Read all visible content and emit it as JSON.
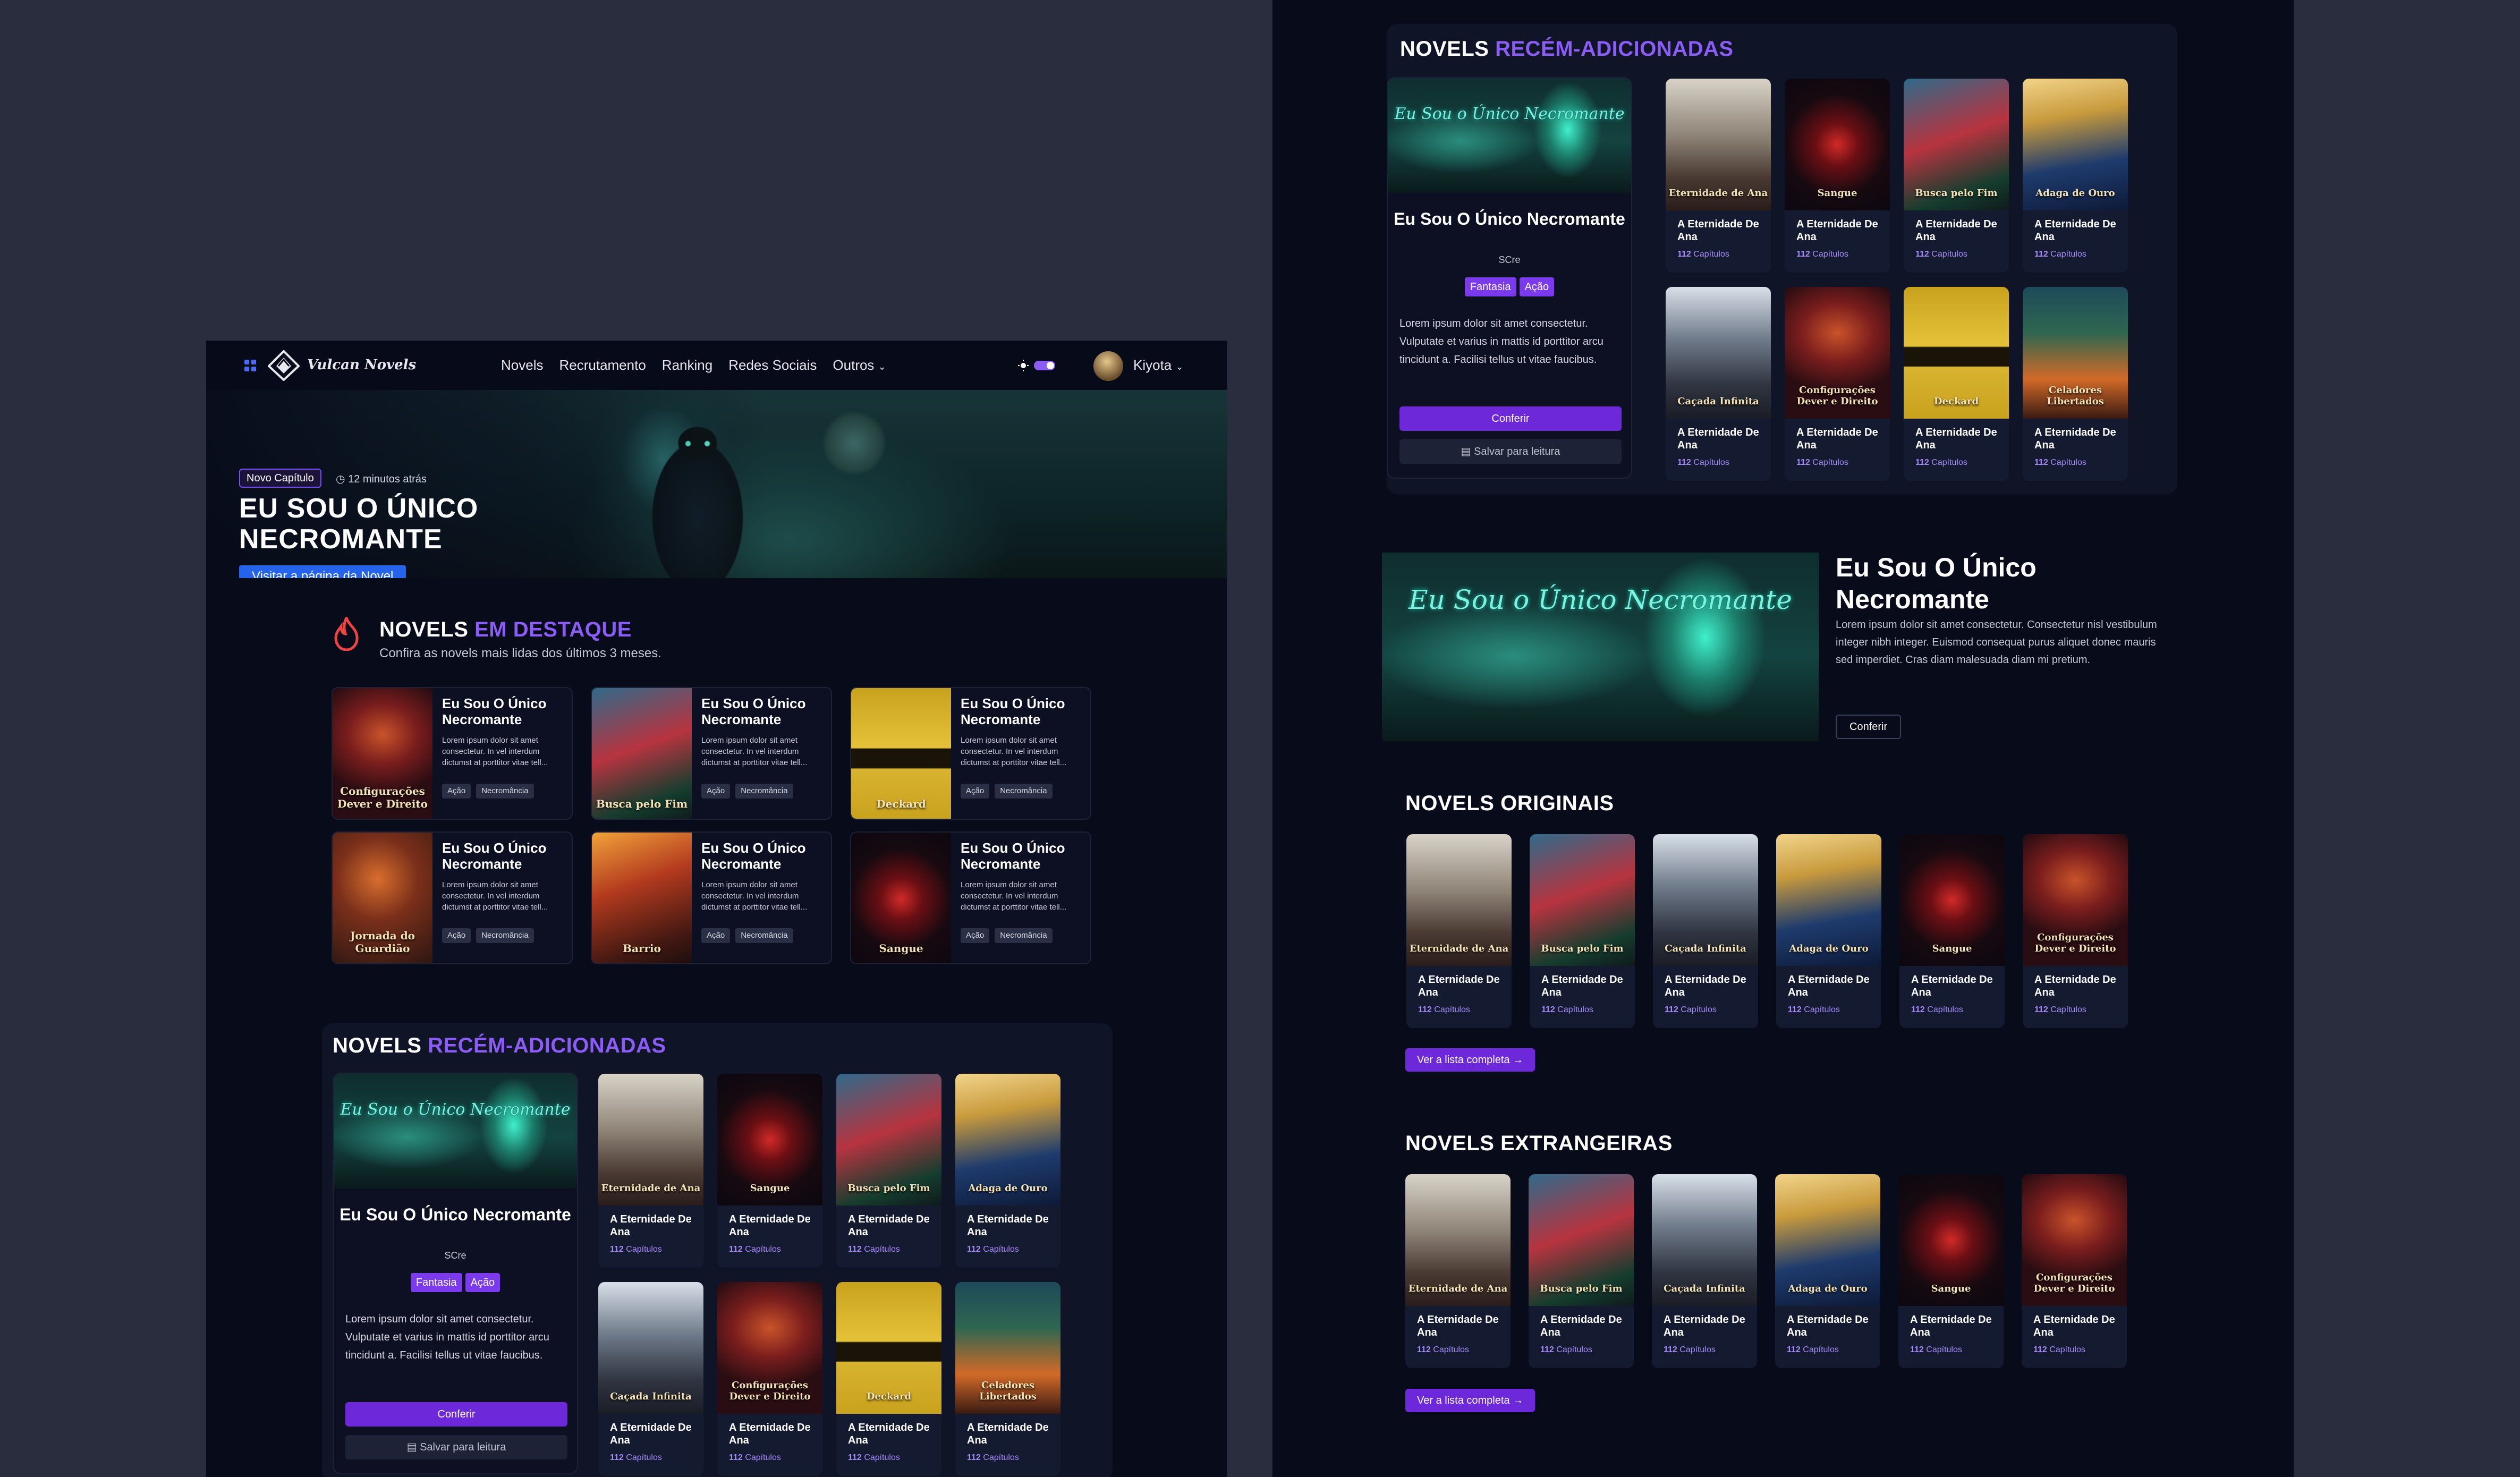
{
  "header": {
    "logo_text": "Vulcan Novels",
    "nav": [
      "Novels",
      "Recrutamento",
      "Ranking",
      "Redes Sociais",
      "Outros"
    ],
    "user_name": "Kiyota",
    "theme": "dark"
  },
  "hero": {
    "badge": "Novo Capítulo",
    "time": "12 minutos atrás",
    "title": "EU SOU O ÚNICO NECROMANTE",
    "button": "Visitar a página da Novel"
  },
  "featured": {
    "title_main": "NOVELS ",
    "title_accent": "EM DESTAQUE",
    "subtitle": "Confira as novels mais lidas dos últimos 3 meses.",
    "cards": [
      {
        "title": "Eu Sou O Único Necromante",
        "desc": "Lorem ipsum dolor sit amet consectetur. In vel interdum dictumst at porttitor vitae tell...",
        "tags": [
          "Ação",
          "Necromância"
        ],
        "cover": "Configurações Dever e Direito"
      },
      {
        "title": "Eu Sou O Único Necromante",
        "desc": "Lorem ipsum dolor sit amet consectetur. In vel interdum dictumst at porttitor vitae tell...",
        "tags": [
          "Ação",
          "Necromância"
        ],
        "cover": "Busca pelo Fim"
      },
      {
        "title": "Eu Sou O Único Necromante",
        "desc": "Lorem ipsum dolor sit amet consectetur. In vel interdum dictumst at porttitor vitae tell...",
        "tags": [
          "Ação",
          "Necromância"
        ],
        "cover": "Deckard"
      },
      {
        "title": "Eu Sou O Único Necromante",
        "desc": "Lorem ipsum dolor sit amet consectetur. In vel interdum dictumst at porttitor vitae tell...",
        "tags": [
          "Ação",
          "Necromância"
        ],
        "cover": "Jornada do Guardião"
      },
      {
        "title": "Eu Sou O Único Necromante",
        "desc": "Lorem ipsum dolor sit amet consectetur. In vel interdum dictumst at porttitor vitae tell...",
        "tags": [
          "Ação",
          "Necromância"
        ],
        "cover": "Barrio"
      },
      {
        "title": "Eu Sou O Único Necromante",
        "desc": "Lorem ipsum dolor sit amet consectetur. In vel interdum dictumst at porttitor vitae tell...",
        "tags": [
          "Ação",
          "Necromância"
        ],
        "cover": "Sangue"
      }
    ]
  },
  "recent": {
    "title_main": "NOVELS ",
    "title_accent": "RECÉM-ADICIONADAS",
    "main_card": {
      "banner_text": "Eu Sou o Único Necromante",
      "title": "Eu Sou O Único Necromante",
      "author": "SCre",
      "tags": [
        "Fantasia",
        "Ação"
      ],
      "desc": "Lorem ipsum dolor sit amet consectetur. Vulputate et varius in mattis id porttitor arcu tincidunt a. Facilisi tellus ut vitae faucibus.",
      "primary": "Conferir",
      "secondary": "Salvar para leitura"
    },
    "grid": [
      {
        "title": "A Eternidade De Ana",
        "count": "112",
        "cover": "Eternidade de Ana",
        "style": "etern"
      },
      {
        "title": "A Eternidade De Ana",
        "count": "112",
        "cover": "Sangue",
        "style": "dark"
      },
      {
        "title": "A Eternidade De Ana",
        "count": "112",
        "cover": "Busca pelo Fim",
        "style": "busca"
      },
      {
        "title": "A Eternidade De Ana",
        "count": "112",
        "cover": "Adaga de Ouro",
        "style": "adaga"
      },
      {
        "title": "A Eternidade De Ana",
        "count": "112",
        "cover": "Caçada Infinita",
        "style": "anime"
      },
      {
        "title": "A Eternidade De Ana",
        "count": "112",
        "cover": "Configurações Dever e Direito",
        "style": "red"
      },
      {
        "title": "A Eternidade De Ana",
        "count": "112",
        "cover": "Deckard",
        "style": "deckard"
      },
      {
        "title": "A Eternidade De Ana",
        "count": "112",
        "cover": "Celadores Libertados",
        "style": "cela"
      }
    ],
    "count_suffix": "Capítulos"
  },
  "promo": {
    "banner_text": "Eu Sou o Único Necromante",
    "title": "Eu Sou O Único Necromante",
    "desc": "Lorem ipsum dolor sit amet consectetur. Consectetur nisl vestibulum integer nibh integer. Euismod consequat purus aliquet donec mauris sed imperdiet. Cras diam malesuada diam mi pretium.",
    "button": "Conferir"
  },
  "originals": {
    "title": "NOVELS ORIGINAIS",
    "button": "Ver a lista completa →",
    "items": [
      {
        "title": "A Eternidade De Ana",
        "count": "112",
        "cover": "Eternidade de Ana",
        "style": "etern"
      },
      {
        "title": "A Eternidade De Ana",
        "count": "112",
        "cover": "Busca pelo Fim",
        "style": "busca"
      },
      {
        "title": "A Eternidade De Ana",
        "count": "112",
        "cover": "Caçada Infinita",
        "style": "anime"
      },
      {
        "title": "A Eternidade De Ana",
        "count": "112",
        "cover": "Adaga de Ouro",
        "style": "adaga"
      },
      {
        "title": "A Eternidade De Ana",
        "count": "112",
        "cover": "Sangue",
        "style": "dark"
      },
      {
        "title": "A Eternidade De Ana",
        "count": "112",
        "cover": "Configurações Dever e Direito",
        "style": "red"
      }
    ]
  },
  "foreign": {
    "title": "NOVELS EXTRANGEIRAS",
    "button": "Ver a lista completa →",
    "items": [
      {
        "title": "A Eternidade De Ana",
        "count": "112",
        "cover": "Eternidade de Ana",
        "style": "etern"
      },
      {
        "title": "A Eternidade De Ana",
        "count": "112",
        "cover": "Busca pelo Fim",
        "style": "busca"
      },
      {
        "title": "A Eternidade De Ana",
        "count": "112",
        "cover": "Caçada Infinita",
        "style": "anime"
      },
      {
        "title": "A Eternidade De Ana",
        "count": "112",
        "cover": "Adaga de Ouro",
        "style": "adaga"
      },
      {
        "title": "A Eternidade De Ana",
        "count": "112",
        "cover": "Sangue",
        "style": "dark"
      },
      {
        "title": "A Eternidade De Ana",
        "count": "112",
        "cover": "Configurações Dever e Direito",
        "style": "red"
      }
    ]
  },
  "colors": {
    "accent": "#8b5cf6",
    "button_primary": "#6d28d9",
    "hero_button": "#2563eb",
    "bg": "#080b1a",
    "canvas": "#2a2d3e"
  }
}
